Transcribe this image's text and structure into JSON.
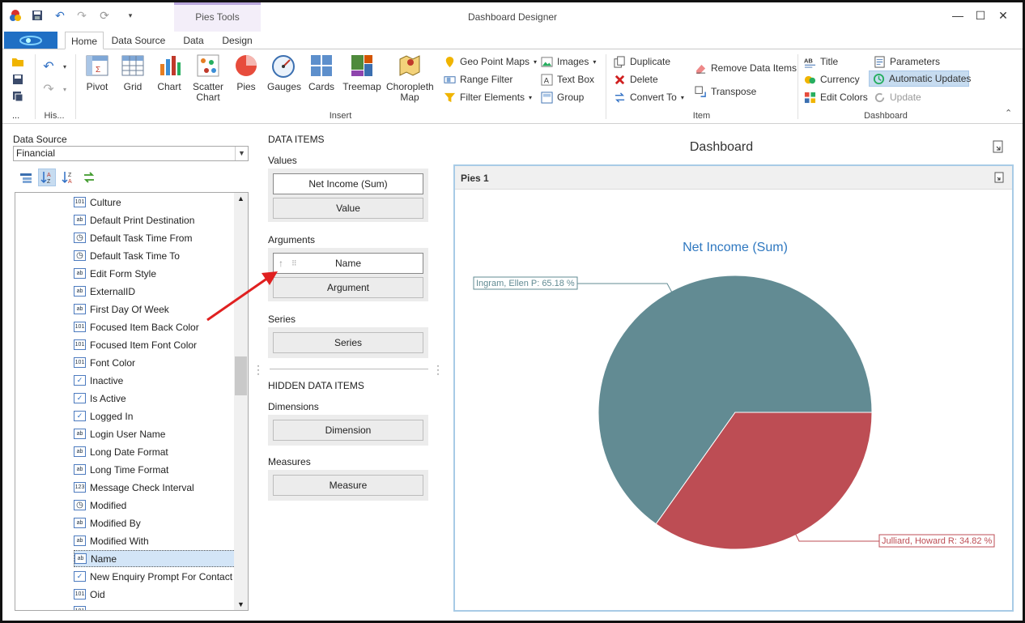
{
  "window": {
    "title": "Dashboard Designer",
    "context_group": "Pies Tools"
  },
  "tabs": [
    {
      "label": "Home",
      "active": true
    },
    {
      "label": "Data Source",
      "active": false
    },
    {
      "label": "Data",
      "active": false
    },
    {
      "label": "Design",
      "active": false
    }
  ],
  "ribbon": {
    "history_label": "His...",
    "more_label": "...",
    "insert": {
      "label": "Insert",
      "buttons": [
        "Pivot",
        "Grid",
        "Chart",
        "Scatter Chart",
        "Pies",
        "Gauges",
        "Cards",
        "Treemap",
        "Choropleth Map"
      ]
    },
    "insert_small": [
      "Geo Point Maps",
      "Range Filter",
      "Filter Elements",
      "Images",
      "Text Box",
      "Group"
    ],
    "item": {
      "label": "Item",
      "buttons": [
        "Duplicate",
        "Delete",
        "Convert To",
        "Remove Data Items",
        "Transpose"
      ]
    },
    "dashboard": {
      "label": "Dashboard",
      "buttons": [
        "Title",
        "Currency",
        "Edit Colors",
        "Parameters",
        "Automatic Updates",
        "Update"
      ]
    }
  },
  "data_source": {
    "label": "Data Source",
    "selected": "Financial"
  },
  "fields": [
    {
      "name": "Culture",
      "type": "101"
    },
    {
      "name": "Default Print Destination",
      "type": "ab"
    },
    {
      "name": "Default Task Time From",
      "type": "clock"
    },
    {
      "name": "Default Task Time To",
      "type": "clock"
    },
    {
      "name": "Edit Form Style",
      "type": "ab"
    },
    {
      "name": "ExternalID",
      "type": "ab"
    },
    {
      "name": "First Day Of Week",
      "type": "ab"
    },
    {
      "name": "Focused Item Back Color",
      "type": "101"
    },
    {
      "name": "Focused Item Font Color",
      "type": "101"
    },
    {
      "name": "Font Color",
      "type": "101"
    },
    {
      "name": "Inactive",
      "type": "check"
    },
    {
      "name": "Is Active",
      "type": "check"
    },
    {
      "name": "Logged In",
      "type": "check"
    },
    {
      "name": "Login User Name",
      "type": "ab"
    },
    {
      "name": "Long Date Format",
      "type": "ab"
    },
    {
      "name": "Long Time Format",
      "type": "ab"
    },
    {
      "name": "Message Check Interval",
      "type": "123"
    },
    {
      "name": "Modified",
      "type": "clock"
    },
    {
      "name": "Modified By",
      "type": "ab"
    },
    {
      "name": "Modified With",
      "type": "ab"
    },
    {
      "name": "Name",
      "type": "ab",
      "selected": true
    },
    {
      "name": "New Enquiry Prompt For Contact ...",
      "type": "check"
    },
    {
      "name": "Oid",
      "type": "101"
    }
  ],
  "data_items": {
    "header": "DATA ITEMS",
    "values_label": "Values",
    "values_item": "Net Income (Sum)",
    "values_placeholder": "Value",
    "arguments_label": "Arguments",
    "arguments_item": "Name",
    "arguments_placeholder": "Argument",
    "series_label": "Series",
    "series_placeholder": "Series",
    "hidden_header": "HIDDEN DATA ITEMS",
    "dimensions_label": "Dimensions",
    "dimensions_placeholder": "Dimension",
    "measures_label": "Measures",
    "measures_placeholder": "Measure"
  },
  "dashboard": {
    "title": "Dashboard",
    "item_title": "Pies 1"
  },
  "chart_data": {
    "type": "pie",
    "title": "Net Income (Sum)",
    "slices": [
      {
        "name": "Ingram, Ellen P",
        "value": 65.18,
        "label": "Ingram, Ellen P: 65.18 %",
        "color": "#628b93"
      },
      {
        "name": "Julliard, Howard R",
        "value": 34.82,
        "label": "Julliard, Howard R: 34.82 %",
        "color": "#bd4d54"
      }
    ]
  }
}
